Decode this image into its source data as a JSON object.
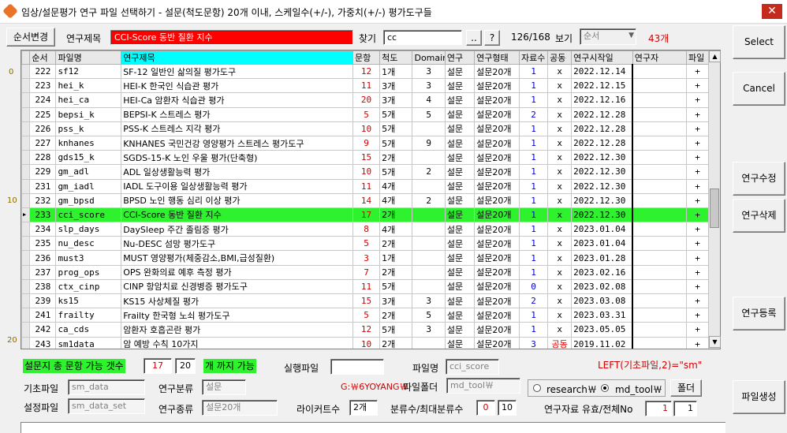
{
  "title": "임상/설문평가 연구 파일 선택하기  - 설문(척도문항) 20개 이내, 스케일수(+/-), 가중치(+/-) 평가도구들",
  "toolbar": {
    "order_change": "순서변경",
    "study_title_label": "연구제목",
    "study_title_value": "CCI-Score 동반 질환 지수",
    "find_label": "찾기",
    "find_value": "cc",
    "dots_button": "..",
    "help_button": "?",
    "position": "126/168",
    "view_label": "보기",
    "view_select": "순서",
    "count": "43개"
  },
  "side_buttons": {
    "select": "Select",
    "cancel": "Cancel",
    "edit": "연구수정",
    "delete": "연구삭제",
    "register": "연구등록",
    "generate": "파일생성"
  },
  "columns": [
    "순서",
    "파일명",
    "연구제목",
    "문항",
    "척도",
    "Domain",
    "연구",
    "연구형태",
    "자료수",
    "공동",
    "연구시작일",
    "연구자",
    "파일"
  ],
  "rows": [
    {
      "n": "222",
      "file": "sf12",
      "title": "SF-12 일반인 삶의질 평가도구",
      "items": "12",
      "scale": "1개",
      "domain": "3",
      "type": "설문",
      "form": "설문20개",
      "data": "1",
      "joint": "x",
      "start": "2022.12.14",
      "researcher": "",
      "file2": "+"
    },
    {
      "n": "223",
      "file": "hei_k",
      "title": "HEI-K 한국인 식습관 평가",
      "items": "11",
      "scale": "3개",
      "domain": "3",
      "type": "설문",
      "form": "설문20개",
      "data": "1",
      "joint": "x",
      "start": "2022.12.15",
      "researcher": "",
      "file2": "+"
    },
    {
      "n": "224",
      "file": "hei_ca",
      "title": "HEI-Ca 암환자 식습관 평가",
      "items": "20",
      "scale": "3개",
      "domain": "4",
      "type": "설문",
      "form": "설문20개",
      "data": "1",
      "joint": "x",
      "start": "2022.12.16",
      "researcher": "",
      "file2": "+"
    },
    {
      "n": "225",
      "file": "bepsi_k",
      "title": "BEPSI-K 스트레스 평가",
      "items": "5",
      "scale": "5개",
      "domain": "5",
      "type": "설문",
      "form": "설문20개",
      "data": "2",
      "joint": "x",
      "start": "2022.12.28",
      "researcher": "",
      "file2": "+"
    },
    {
      "n": "226",
      "file": "pss_k",
      "title": "PSS-K 스트레스 지각 평가",
      "items": "10",
      "scale": "5개",
      "domain": "",
      "type": "설문",
      "form": "설문20개",
      "data": "1",
      "joint": "x",
      "start": "2022.12.28",
      "researcher": "",
      "file2": "+"
    },
    {
      "n": "227",
      "file": "knhanes",
      "title": "KNHANES 국민건강 영양평가 스트레스 평가도구",
      "items": "9",
      "scale": "5개",
      "domain": "9",
      "type": "설문",
      "form": "설문20개",
      "data": "1",
      "joint": "x",
      "start": "2022.12.28",
      "researcher": "",
      "file2": "+"
    },
    {
      "n": "228",
      "file": "gds15_k",
      "title": "SGDS-15-K 노인 우울 평가(단축형)",
      "items": "15",
      "scale": "2개",
      "domain": "",
      "type": "설문",
      "form": "설문20개",
      "data": "1",
      "joint": "x",
      "start": "2022.12.30",
      "researcher": "",
      "file2": "+"
    },
    {
      "n": "229",
      "file": "gm_adl",
      "title": "ADL 일상생활능력 평가",
      "items": "10",
      "scale": "5개",
      "domain": "2",
      "type": "설문",
      "form": "설문20개",
      "data": "1",
      "joint": "x",
      "start": "2022.12.30",
      "researcher": "",
      "file2": "+"
    },
    {
      "n": "231",
      "file": "gm_iadl",
      "title": "IADL 도구이용 일상생활능력 평가",
      "items": "11",
      "scale": "4개",
      "domain": "",
      "type": "설문",
      "form": "설문20개",
      "data": "1",
      "joint": "x",
      "start": "2022.12.30",
      "researcher": "",
      "file2": "+"
    },
    {
      "n": "232",
      "file": "gm_bpsd",
      "title": "BPSD 노인 행동 심리 이상 평가",
      "items": "14",
      "scale": "4개",
      "domain": "2",
      "type": "설문",
      "form": "설문20개",
      "data": "1",
      "joint": "x",
      "start": "2022.12.30",
      "researcher": "",
      "file2": "+"
    },
    {
      "n": "233",
      "file": "cci_score",
      "title": "CCI-Score 동반 질환 지수",
      "items": "17",
      "scale": "2개",
      "domain": "",
      "type": "설문",
      "form": "설문20개",
      "data": "1",
      "joint": "x",
      "start": "2022.12.30",
      "researcher": "",
      "file2": "+",
      "selected": true
    },
    {
      "n": "234",
      "file": "slp_days",
      "title": "DaySleep 주간 졸림증 평가",
      "items": "8",
      "scale": "4개",
      "domain": "",
      "type": "설문",
      "form": "설문20개",
      "data": "1",
      "joint": "x",
      "start": "2023.01.04",
      "researcher": "",
      "file2": "+"
    },
    {
      "n": "235",
      "file": "nu_desc",
      "title": "Nu-DESC 섬망 평가도구",
      "items": "5",
      "scale": "2개",
      "domain": "",
      "type": "설문",
      "form": "설문20개",
      "data": "1",
      "joint": "x",
      "start": "2023.01.04",
      "researcher": "",
      "file2": "+"
    },
    {
      "n": "236",
      "file": "must3",
      "title": "MUST 영양평가(체중감소,BMI,급성질환)",
      "items": "3",
      "scale": "1개",
      "domain": "",
      "type": "설문",
      "form": "설문20개",
      "data": "1",
      "joint": "x",
      "start": "2023.01.28",
      "researcher": "",
      "file2": "+"
    },
    {
      "n": "237",
      "file": "prog_ops",
      "title": "OPS 완화의료 예후 측정 평가",
      "items": "7",
      "scale": "2개",
      "domain": "",
      "type": "설문",
      "form": "설문20개",
      "data": "1",
      "joint": "x",
      "start": "2023.02.16",
      "researcher": "",
      "file2": "+"
    },
    {
      "n": "238",
      "file": "ctx_cinp",
      "title": "CINP 항암치료 신경병증 평가도구",
      "items": "11",
      "scale": "5개",
      "domain": "",
      "type": "설문",
      "form": "설문20개",
      "data": "0",
      "joint": "x",
      "start": "2023.02.08",
      "researcher": "",
      "file2": "+"
    },
    {
      "n": "239",
      "file": "ks15",
      "title": "KS15 사상체질 평가",
      "items": "15",
      "scale": "3개",
      "domain": "3",
      "type": "설문",
      "form": "설문20개",
      "data": "2",
      "joint": "x",
      "start": "2023.03.08",
      "researcher": "",
      "file2": "+"
    },
    {
      "n": "241",
      "file": "frailty",
      "title": "Frailty 한국형 노쇠 평가도구",
      "items": "5",
      "scale": "2개",
      "domain": "5",
      "type": "설문",
      "form": "설문20개",
      "data": "1",
      "joint": "x",
      "start": "2023.03.31",
      "researcher": "",
      "file2": "+"
    },
    {
      "n": "242",
      "file": "ca_cds",
      "title": "암환자 호흡곤란 평가",
      "items": "12",
      "scale": "5개",
      "domain": "3",
      "type": "설문",
      "form": "설문20개",
      "data": "1",
      "joint": "x",
      "start": "2023.05.05",
      "researcher": "",
      "file2": "+"
    },
    {
      "n": "243",
      "file": "sm1data",
      "title": "암 예방 수칙 10가지",
      "items": "10",
      "scale": "2개",
      "domain": "",
      "type": "설문",
      "form": "설문20개",
      "data": "3",
      "joint": "공동",
      "start": "2019.11.02",
      "researcher": "",
      "file2": "+"
    }
  ],
  "row_markers": {
    "top": "0",
    "middle": "10",
    "bottom": "20"
  },
  "bottom": {
    "max_items_label": "설문지 총 문항 가능 갯수",
    "max_items_value": "17",
    "max_items_limit": "20",
    "max_items_suffix": "개 까지 가능",
    "exec_file_label": "실행파일",
    "exec_file_value": "",
    "filename_label": "파일명",
    "filename_value": "cci_score",
    "left_hint": "LEFT(기초파일,2)=\"sm\"",
    "base_file_label": "기초파일",
    "base_file_value": "sm_data",
    "category_label": "연구분류",
    "category_value": "설문",
    "path": "G:￦6YOYANG￦",
    "folder_label": "파일폴더",
    "folder_value": "md_tool￦",
    "radio_research": "research￦",
    "radio_mdtool": "md_tool￦",
    "folder_button": "폴더",
    "settings_label": "설정파일",
    "settings_value": "sm_data_set",
    "type_label": "연구종류",
    "type_value": "설문20개",
    "likert_label": "라이커트수",
    "likert_value": "2개",
    "classes_label": "분류수/최대분류수",
    "classes_value": "0",
    "classes_max": "10",
    "valid_label": "연구자료 유효/전체No",
    "valid_value": "1",
    "valid_total": "1"
  }
}
